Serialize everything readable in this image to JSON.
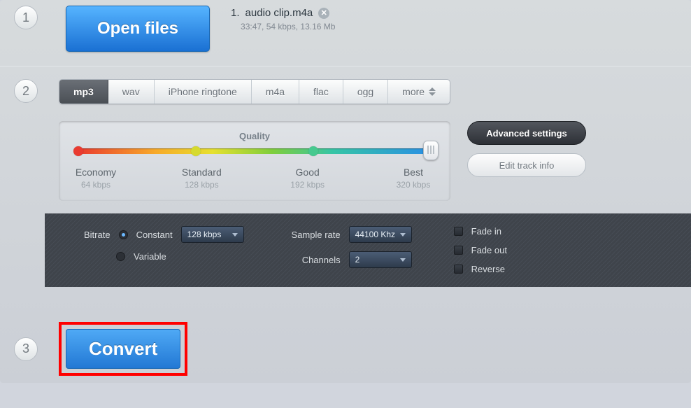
{
  "step1": {
    "num": "1",
    "open_label": "Open files",
    "file": {
      "index": "1.",
      "name": "audio clip.m4a",
      "meta": "33:47, 54 kbps, 13.16 Mb"
    }
  },
  "step2": {
    "num": "2",
    "tabs": [
      "mp3",
      "wav",
      "iPhone ringtone",
      "m4a",
      "flac",
      "ogg",
      "more"
    ],
    "quality": {
      "title": "Quality",
      "stops": [
        {
          "name": "Economy",
          "val": "64 kbps"
        },
        {
          "name": "Standard",
          "val": "128 kbps"
        },
        {
          "name": "Good",
          "val": "192 kbps"
        },
        {
          "name": "Best",
          "val": "320 kbps"
        }
      ]
    },
    "adv_btn": "Advanced settings",
    "edit_btn": "Edit track info",
    "advanced": {
      "bitrate_label": "Bitrate",
      "constant": "Constant",
      "variable": "Variable",
      "bitrate_val": "128 kbps",
      "sample_label": "Sample rate",
      "sample_val": "44100 Khz",
      "channels_label": "Channels",
      "channels_val": "2",
      "fade_in": "Fade in",
      "fade_out": "Fade out",
      "reverse": "Reverse"
    }
  },
  "step3": {
    "num": "3",
    "convert": "Convert"
  }
}
